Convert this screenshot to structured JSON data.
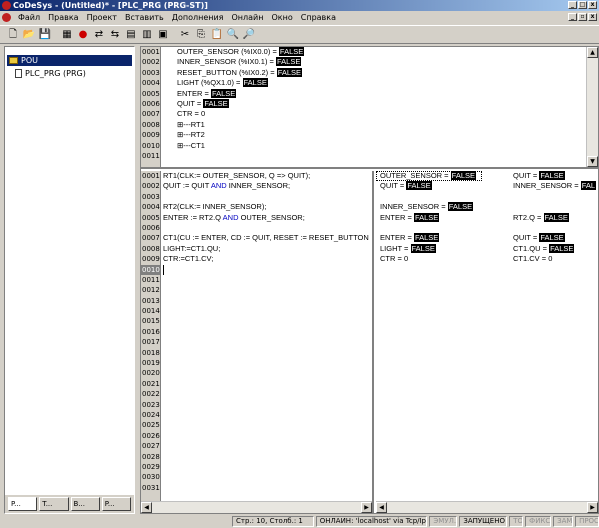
{
  "window": {
    "title": "CoDeSys - (Untitled)* - [PLC_PRG (PRG-ST)]"
  },
  "menu": [
    "Файл",
    "Правка",
    "Проект",
    "Вставить",
    "Дополнения",
    "Онлайн",
    "Окно",
    "Справка"
  ],
  "toolbar_icons": [
    "new-icon",
    "open-icon",
    "save-icon",
    "compile-icon",
    "stop-icon",
    "login-icon",
    "logout-icon",
    "run-icon",
    "step-icon",
    "cut-icon",
    "copy-icon",
    "paste-icon",
    "find-icon",
    "replace-icon"
  ],
  "tree": {
    "root": "POU",
    "child": "PLC_PRG (PRG)"
  },
  "left_tabs": [
    "P...",
    "T...",
    "B...",
    "P..."
  ],
  "declaration": {
    "lines": [
      "0001",
      "0002",
      "0003",
      "0004",
      "0005",
      "0006",
      "0007",
      "0008",
      "0009",
      "0010",
      "0011"
    ],
    "code": [
      {
        "pre": "OUTER_SENSOR (%IX0.0) = ",
        "val": "FALSE"
      },
      {
        "pre": "INNER_SENSOR (%IX0.1) = ",
        "val": "FALSE"
      },
      {
        "pre": "RESET_BUTTON (%IX0.2) = ",
        "val": "FALSE"
      },
      {
        "pre": "LIGHT (%QX1.0) = ",
        "val": "FALSE"
      },
      {
        "pre": "ENTER = ",
        "val": "FALSE"
      },
      {
        "pre": "QUIT = ",
        "val": "FALSE"
      },
      {
        "pre": "CTR = 0",
        "val": ""
      },
      {
        "pre": "⊞---RT1",
        "val": ""
      },
      {
        "pre": "⊞---RT2",
        "val": ""
      },
      {
        "pre": "⊞---CT1",
        "val": ""
      },
      {
        "pre": "",
        "val": ""
      }
    ]
  },
  "body": {
    "lines": [
      "0001",
      "0002",
      "0003",
      "0004",
      "0005",
      "0006",
      "0007",
      "0008",
      "0009",
      "0010",
      "0011",
      "0012",
      "0013",
      "0014",
      "0015",
      "0016",
      "0017",
      "0018",
      "0019",
      "0020",
      "0021",
      "0022",
      "0023",
      "0024",
      "0025",
      "0026",
      "0027",
      "0028",
      "0029",
      "0030",
      "0031"
    ],
    "code": [
      "RT1(CLK:= OUTER_SENSOR, Q => QUIT);",
      "QUIT := QUIT AND INNER_SENSOR;",
      "",
      "RT2(CLK:= INNER_SENSOR);",
      "ENTER := RT2.Q AND OUTER_SENSOR;",
      "",
      "CT1(CU := ENTER, CD := QUIT, RESET := RESET_BUTTON",
      "LIGHT:=CT1.QU;",
      "CTR:=CT1.CV;"
    ]
  },
  "monitor": {
    "rows": [
      [
        {
          "t": "OUTER_SENSOR = ",
          "v": "FALSE"
        },
        {
          "t": "QUIT = ",
          "v": "FALSE"
        }
      ],
      [
        {
          "t": "QUIT = ",
          "v": "FALSE"
        },
        {
          "t": "INNER_SENSOR = ",
          "v": "FAL"
        }
      ],
      [],
      [
        {
          "t": "INNER_SENSOR = ",
          "v": "FALSE"
        },
        {
          "t": "",
          "v": ""
        }
      ],
      [
        {
          "t": "ENTER = ",
          "v": "FALSE"
        },
        {
          "t": "RT2.Q = ",
          "v": "FALSE"
        }
      ],
      [],
      [
        {
          "t": "ENTER = ",
          "v": "FALSE"
        },
        {
          "t": "QUIT = ",
          "v": "FALSE"
        }
      ],
      [
        {
          "t": "LIGHT = ",
          "v": "FALSE"
        },
        {
          "t": "CT1.QU = ",
          "v": "FALSE"
        }
      ],
      [
        {
          "t": "CTR = 0",
          "v": ""
        },
        {
          "t": "CT1.CV = 0",
          "v": ""
        }
      ]
    ]
  },
  "status": [
    "Стр.: 10, Столб.: 1",
    "ОНЛАЙН: 'localhost' via Tcp/Ip",
    "ЭМУЛ.",
    "ЗАПУЩЕНО",
    "ТО",
    "ФИКС",
    "ЗАМ",
    "ПРОС"
  ]
}
